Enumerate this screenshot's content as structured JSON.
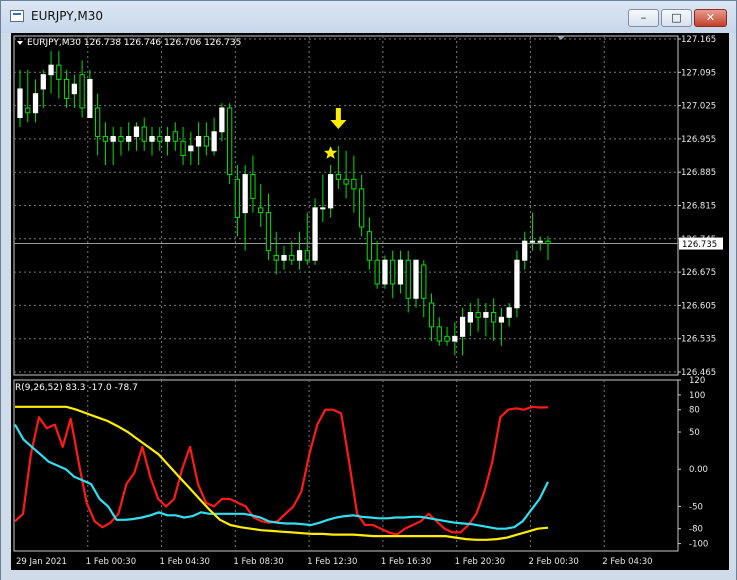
{
  "window": {
    "title": "EURJPY,M30",
    "min_glyph": "–",
    "max_glyph": "□",
    "close_glyph": "✕",
    "icon": "chart-window-icon"
  },
  "chart_data": {
    "type": "candlestick",
    "symbol_line": "EURJPY,M30  126.738 126.746 126.706 126.735",
    "current_price_label": "126.735",
    "price_axis_ticks": [
      "127.165",
      "127.095",
      "127.025",
      "126.955",
      "126.885",
      "126.815",
      "126.745",
      "126.675",
      "126.605",
      "126.535",
      "126.465"
    ],
    "price_range": [
      126.465,
      127.165
    ],
    "current_price": 126.735,
    "time_labels": [
      "29 Jan 2021",
      "1 Feb 00:30",
      "1 Feb 04:30",
      "1 Feb 08:30",
      "1 Feb 12:30",
      "1 Feb 16:30",
      "1 Feb 20:30",
      "2 Feb 00:30",
      "2 Feb 04:30"
    ],
    "candles": [
      {
        "o": 127.0,
        "h": 127.1,
        "l": 126.98,
        "c": 127.06
      },
      {
        "o": 127.02,
        "h": 127.1,
        "l": 126.99,
        "c": 127.01
      },
      {
        "o": 127.01,
        "h": 127.08,
        "l": 126.99,
        "c": 127.05
      },
      {
        "o": 127.06,
        "h": 127.1,
        "l": 127.02,
        "c": 127.09
      },
      {
        "o": 127.09,
        "h": 127.14,
        "l": 127.05,
        "c": 127.11
      },
      {
        "o": 127.11,
        "h": 127.14,
        "l": 127.04,
        "c": 127.08
      },
      {
        "o": 127.08,
        "h": 127.1,
        "l": 127.02,
        "c": 127.04
      },
      {
        "o": 127.05,
        "h": 127.09,
        "l": 127.02,
        "c": 127.07
      },
      {
        "o": 127.09,
        "h": 127.12,
        "l": 127.0,
        "c": 127.02
      },
      {
        "o": 127.0,
        "h": 127.1,
        "l": 127.0,
        "c": 127.08
      },
      {
        "o": 127.02,
        "h": 127.05,
        "l": 126.92,
        "c": 126.96
      },
      {
        "o": 126.96,
        "h": 126.99,
        "l": 126.9,
        "c": 126.95
      },
      {
        "o": 126.95,
        "h": 126.98,
        "l": 126.9,
        "c": 126.96
      },
      {
        "o": 126.96,
        "h": 126.98,
        "l": 126.92,
        "c": 126.95
      },
      {
        "o": 126.95,
        "h": 126.99,
        "l": 126.93,
        "c": 126.96
      },
      {
        "o": 126.96,
        "h": 126.99,
        "l": 126.93,
        "c": 126.98
      },
      {
        "o": 126.98,
        "h": 127.0,
        "l": 126.93,
        "c": 126.95
      },
      {
        "o": 126.95,
        "h": 126.98,
        "l": 126.92,
        "c": 126.96
      },
      {
        "o": 126.96,
        "h": 126.98,
        "l": 126.93,
        "c": 126.95
      },
      {
        "o": 126.95,
        "h": 126.98,
        "l": 126.92,
        "c": 126.96
      },
      {
        "o": 126.97,
        "h": 126.99,
        "l": 126.93,
        "c": 126.95
      },
      {
        "o": 126.95,
        "h": 126.98,
        "l": 126.9,
        "c": 126.92
      },
      {
        "o": 126.93,
        "h": 126.97,
        "l": 126.9,
        "c": 126.94
      },
      {
        "o": 126.94,
        "h": 126.99,
        "l": 126.9,
        "c": 126.96
      },
      {
        "o": 126.96,
        "h": 126.99,
        "l": 126.92,
        "c": 126.94
      },
      {
        "o": 126.93,
        "h": 127.0,
        "l": 126.92,
        "c": 126.97
      },
      {
        "o": 126.97,
        "h": 127.03,
        "l": 126.95,
        "c": 127.02
      },
      {
        "o": 127.02,
        "h": 127.03,
        "l": 126.86,
        "c": 126.88
      },
      {
        "o": 126.87,
        "h": 126.9,
        "l": 126.75,
        "c": 126.79
      },
      {
        "o": 126.8,
        "h": 126.9,
        "l": 126.72,
        "c": 126.88
      },
      {
        "o": 126.88,
        "h": 126.92,
        "l": 126.8,
        "c": 126.83
      },
      {
        "o": 126.81,
        "h": 126.86,
        "l": 126.77,
        "c": 126.8
      },
      {
        "o": 126.8,
        "h": 126.84,
        "l": 126.7,
        "c": 126.72
      },
      {
        "o": 126.71,
        "h": 126.76,
        "l": 126.67,
        "c": 126.7
      },
      {
        "o": 126.7,
        "h": 126.73,
        "l": 126.68,
        "c": 126.71
      },
      {
        "o": 126.71,
        "h": 126.74,
        "l": 126.69,
        "c": 126.7
      },
      {
        "o": 126.7,
        "h": 126.76,
        "l": 126.68,
        "c": 126.72
      },
      {
        "o": 126.72,
        "h": 126.8,
        "l": 126.69,
        "c": 126.7
      },
      {
        "o": 126.7,
        "h": 126.83,
        "l": 126.69,
        "c": 126.81
      },
      {
        "o": 126.81,
        "h": 126.88,
        "l": 126.78,
        "c": 126.81
      },
      {
        "o": 126.81,
        "h": 126.9,
        "l": 126.79,
        "c": 126.88
      },
      {
        "o": 126.88,
        "h": 126.94,
        "l": 126.85,
        "c": 126.87
      },
      {
        "o": 126.87,
        "h": 126.93,
        "l": 126.83,
        "c": 126.86
      },
      {
        "o": 126.87,
        "h": 126.92,
        "l": 126.8,
        "c": 126.85
      },
      {
        "o": 126.85,
        "h": 126.88,
        "l": 126.75,
        "c": 126.77
      },
      {
        "o": 126.76,
        "h": 126.79,
        "l": 126.68,
        "c": 126.7
      },
      {
        "o": 126.7,
        "h": 126.74,
        "l": 126.64,
        "c": 126.65
      },
      {
        "o": 126.65,
        "h": 126.71,
        "l": 126.64,
        "c": 126.7
      },
      {
        "o": 126.7,
        "h": 126.72,
        "l": 126.62,
        "c": 126.65
      },
      {
        "o": 126.65,
        "h": 126.72,
        "l": 126.63,
        "c": 126.7
      },
      {
        "o": 126.7,
        "h": 126.72,
        "l": 126.59,
        "c": 126.62
      },
      {
        "o": 126.62,
        "h": 126.7,
        "l": 126.6,
        "c": 126.7
      },
      {
        "o": 126.69,
        "h": 126.7,
        "l": 126.58,
        "c": 126.62
      },
      {
        "o": 126.61,
        "h": 126.63,
        "l": 126.53,
        "c": 126.56
      },
      {
        "o": 126.56,
        "h": 126.58,
        "l": 126.52,
        "c": 126.53
      },
      {
        "o": 126.54,
        "h": 126.56,
        "l": 126.52,
        "c": 126.53
      },
      {
        "o": 126.53,
        "h": 126.57,
        "l": 126.5,
        "c": 126.54
      },
      {
        "o": 126.54,
        "h": 126.6,
        "l": 126.5,
        "c": 126.58
      },
      {
        "o": 126.57,
        "h": 126.61,
        "l": 126.54,
        "c": 126.59
      },
      {
        "o": 126.59,
        "h": 126.62,
        "l": 126.55,
        "c": 126.58
      },
      {
        "o": 126.58,
        "h": 126.61,
        "l": 126.54,
        "c": 126.59
      },
      {
        "o": 126.59,
        "h": 126.62,
        "l": 126.53,
        "c": 126.57
      },
      {
        "o": 126.57,
        "h": 126.6,
        "l": 126.52,
        "c": 126.58
      },
      {
        "o": 126.58,
        "h": 126.61,
        "l": 126.56,
        "c": 126.6
      },
      {
        "o": 126.6,
        "h": 126.72,
        "l": 126.58,
        "c": 126.7
      },
      {
        "o": 126.7,
        "h": 126.76,
        "l": 126.68,
        "c": 126.74
      },
      {
        "o": 126.74,
        "h": 126.8,
        "l": 126.72,
        "c": 126.74
      },
      {
        "o": 126.74,
        "h": 126.75,
        "l": 126.72,
        "c": 126.74
      },
      {
        "o": 126.74,
        "h": 126.75,
        "l": 126.7,
        "c": 126.735
      }
    ],
    "candle_colors": {
      "body": "#ffffff",
      "wick": "#00e000"
    },
    "signal_markers": {
      "arrow_index": 41,
      "star_index": 40,
      "color": "#ffee00"
    },
    "indicator": {
      "label": "R(9,26,52) 83.3 -17.0 -78.7",
      "axis_ticks": [
        "120",
        "100",
        "80",
        "50",
        "0.00",
        "-50",
        "-80",
        "-100"
      ],
      "range": [
        -110,
        120
      ],
      "series": [
        {
          "color": "#ff1a1a",
          "values": [
            -70,
            -60,
            20,
            70,
            55,
            60,
            30,
            68,
            10,
            -45,
            -70,
            -78,
            -72,
            -60,
            -20,
            -5,
            30,
            -10,
            -40,
            -50,
            -40,
            0,
            30,
            -20,
            -45,
            -50,
            -40,
            -40,
            -45,
            -50,
            -65,
            -70,
            -72,
            -70,
            -60,
            -50,
            -30,
            20,
            60,
            80,
            80,
            75,
            10,
            -60,
            -75,
            -75,
            -80,
            -85,
            -88,
            -80,
            -75,
            -70,
            -60,
            -70,
            -80,
            -85,
            -85,
            -75,
            -60,
            -30,
            10,
            70,
            80,
            82,
            80,
            84,
            83,
            83.3
          ]
        },
        {
          "color": "#30e0f0",
          "values": [
            60,
            40,
            30,
            20,
            10,
            5,
            0,
            -10,
            -15,
            -20,
            -40,
            -50,
            -68,
            -68,
            -67,
            -65,
            -62,
            -58,
            -62,
            -62,
            -65,
            -63,
            -58,
            -60,
            -60,
            -60,
            -60,
            -60,
            -62,
            -65,
            -70,
            -72,
            -73,
            -73,
            -74,
            -75,
            -72,
            -68,
            -65,
            -63,
            -62,
            -64,
            -65,
            -66,
            -66,
            -65,
            -65,
            -64,
            -64,
            -66,
            -68,
            -70,
            -72,
            -73,
            -74,
            -76,
            -78,
            -80,
            -80,
            -78,
            -70,
            -55,
            -40,
            -17
          ]
        },
        {
          "color": "#ffee00",
          "values": [
            84,
            84,
            84,
            84,
            84,
            84,
            80,
            75,
            70,
            65,
            58,
            50,
            40,
            30,
            20,
            5,
            -10,
            -25,
            -40,
            -55,
            -68,
            -75,
            -78,
            -80,
            -82,
            -83,
            -84,
            -85,
            -86,
            -87,
            -87,
            -88,
            -88,
            -88,
            -89,
            -90,
            -90,
            -90,
            -90,
            -90,
            -90,
            -90,
            -90,
            -92,
            -94,
            -95,
            -95,
            -94,
            -92,
            -88,
            -84,
            -80,
            -78.7
          ]
        }
      ]
    }
  }
}
